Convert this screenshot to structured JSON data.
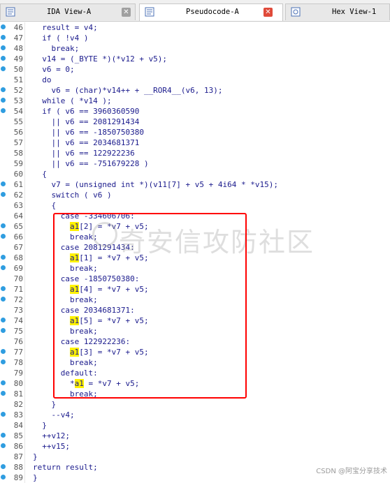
{
  "tabs": [
    {
      "label": "IDA View-A",
      "active": false,
      "icon": "ida-view-icon",
      "close": "grey"
    },
    {
      "label": "Pseudocode-A",
      "active": true,
      "icon": "pseudocode-icon",
      "close": "red"
    },
    {
      "label": "Hex View-1",
      "active": false,
      "icon": "hex-view-icon",
      "close": ""
    }
  ],
  "code": [
    {
      "n": "46",
      "bp": true,
      "text": "  result = v4;"
    },
    {
      "n": "47",
      "bp": true,
      "text": "  if ( !v4 )"
    },
    {
      "n": "48",
      "bp": true,
      "text": "    break;"
    },
    {
      "n": "49",
      "bp": true,
      "text": "  v14 = (_BYTE *)(*v12 + v5);"
    },
    {
      "n": "50",
      "bp": true,
      "text": "  v6 = 0;"
    },
    {
      "n": "51",
      "bp": false,
      "text": "  do"
    },
    {
      "n": "52",
      "bp": true,
      "text": "    v6 = (char)*v14++ + __ROR4__(v6, 13);"
    },
    {
      "n": "53",
      "bp": true,
      "text": "  while ( *v14 );"
    },
    {
      "n": "54",
      "bp": true,
      "text": "  if ( v6 == 3960360590"
    },
    {
      "n": "55",
      "bp": false,
      "text": "    || v6 == 2081291434"
    },
    {
      "n": "56",
      "bp": false,
      "text": "    || v6 == -1850750380"
    },
    {
      "n": "57",
      "bp": false,
      "text": "    || v6 == 2034681371"
    },
    {
      "n": "58",
      "bp": false,
      "text": "    || v6 == 122922236"
    },
    {
      "n": "59",
      "bp": false,
      "text": "    || v6 == -751679228 )"
    },
    {
      "n": "60",
      "bp": false,
      "text": "  {"
    },
    {
      "n": "61",
      "bp": true,
      "text": "    v7 = (unsigned int *)(v11[7] + v5 + 4i64 * *v15);"
    },
    {
      "n": "62",
      "bp": true,
      "text": "    switch ( v6 )"
    },
    {
      "n": "63",
      "bp": false,
      "text": "    {"
    },
    {
      "n": "64",
      "bp": false,
      "text": "      case -334606706:"
    },
    {
      "n": "65",
      "bp": true,
      "text": "        a1[2] = *v7 + v5;",
      "hl": "a1"
    },
    {
      "n": "66",
      "bp": true,
      "text": "        break;"
    },
    {
      "n": "67",
      "bp": false,
      "text": "      case 2081291434:"
    },
    {
      "n": "68",
      "bp": true,
      "text": "        a1[1] = *v7 + v5;",
      "hl": "a1"
    },
    {
      "n": "69",
      "bp": true,
      "text": "        break;"
    },
    {
      "n": "70",
      "bp": false,
      "text": "      case -1850750380:"
    },
    {
      "n": "71",
      "bp": true,
      "text": "        a1[4] = *v7 + v5;",
      "hl": "a1"
    },
    {
      "n": "72",
      "bp": true,
      "text": "        break;"
    },
    {
      "n": "73",
      "bp": false,
      "text": "      case 2034681371:"
    },
    {
      "n": "74",
      "bp": true,
      "text": "        a1[5] = *v7 + v5;",
      "hl": "a1"
    },
    {
      "n": "75",
      "bp": true,
      "text": "        break;"
    },
    {
      "n": "76",
      "bp": false,
      "text": "      case 122922236:"
    },
    {
      "n": "77",
      "bp": true,
      "text": "        a1[3] = *v7 + v5;",
      "hl": "a1"
    },
    {
      "n": "78",
      "bp": true,
      "text": "        break;"
    },
    {
      "n": "79",
      "bp": false,
      "text": "      default:"
    },
    {
      "n": "80",
      "bp": true,
      "text": "        *a1 = *v7 + v5;",
      "hl": "a1"
    },
    {
      "n": "81",
      "bp": true,
      "text": "        break;"
    },
    {
      "n": "82",
      "bp": false,
      "text": "    }"
    },
    {
      "n": "83",
      "bp": true,
      "text": "    --v4;"
    },
    {
      "n": "84",
      "bp": false,
      "text": "  }"
    },
    {
      "n": "85",
      "bp": true,
      "text": "  ++v12;"
    },
    {
      "n": "86",
      "bp": true,
      "text": "  ++v15;"
    },
    {
      "n": "87",
      "bp": false,
      "text": "}"
    },
    {
      "n": "88",
      "bp": true,
      "text": "return result;"
    },
    {
      "n": "89",
      "bp": true,
      "text": "}"
    }
  ],
  "watermark": "奇安信攻防社区",
  "credit": "CSDN @阿宝分享技术",
  "colors": {
    "breakpoint": "#2f9de0",
    "highlight": "#fff200",
    "box": "#ff0000",
    "code": "#1a1a8c"
  }
}
